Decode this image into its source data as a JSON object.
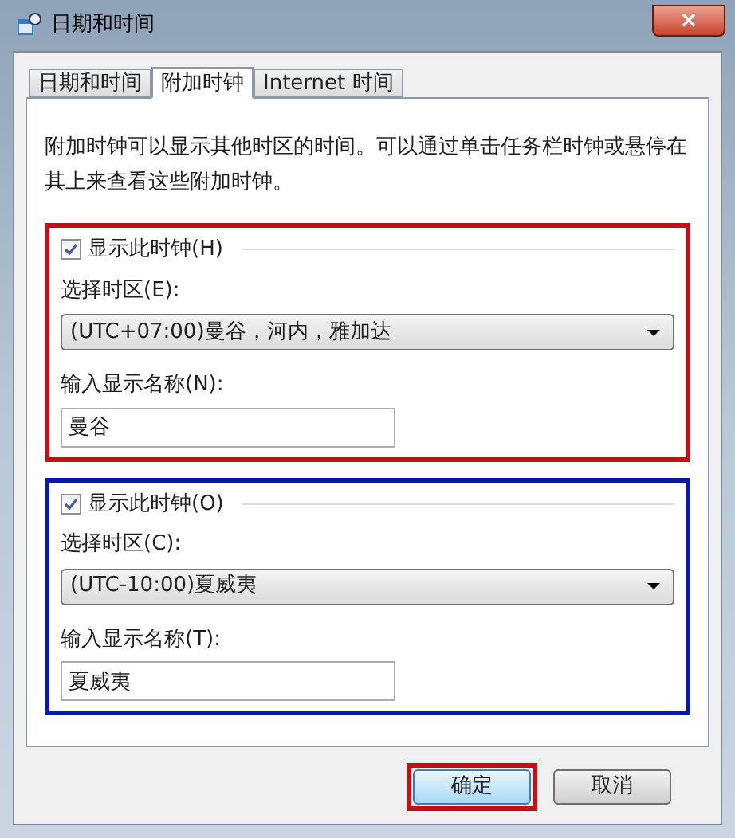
{
  "window": {
    "title": "日期和时间",
    "close": "×"
  },
  "tabs": [
    {
      "label": "日期和时间",
      "selected": false
    },
    {
      "label": "附加时钟",
      "selected": true
    },
    {
      "label": "Internet 时间",
      "selected": false
    }
  ],
  "description": "附加时钟可以显示其他时区的时间。可以通过单击任务栏时钟或悬停在其上来查看这些附加时钟。",
  "clocks": [
    {
      "color": "#c0101a",
      "show_label": "显示此时钟(H)",
      "checked": true,
      "timezone_label": "选择时区(E):",
      "timezone": "(UTC+07:00)曼谷，河内，雅加达",
      "name_label": "输入显示名称(N):",
      "name": "曼谷"
    },
    {
      "color": "#0a1aa0",
      "show_label": "显示此时钟(O)",
      "checked": true,
      "timezone_label": "选择时区(C):",
      "timezone": "(UTC-10:00)夏威夷",
      "name_label": "输入显示名称(T):",
      "name": "夏威夷"
    }
  ],
  "buttons": [
    {
      "label": "确定",
      "highlighted": true
    },
    {
      "label": "取消",
      "highlighted": false
    }
  ]
}
